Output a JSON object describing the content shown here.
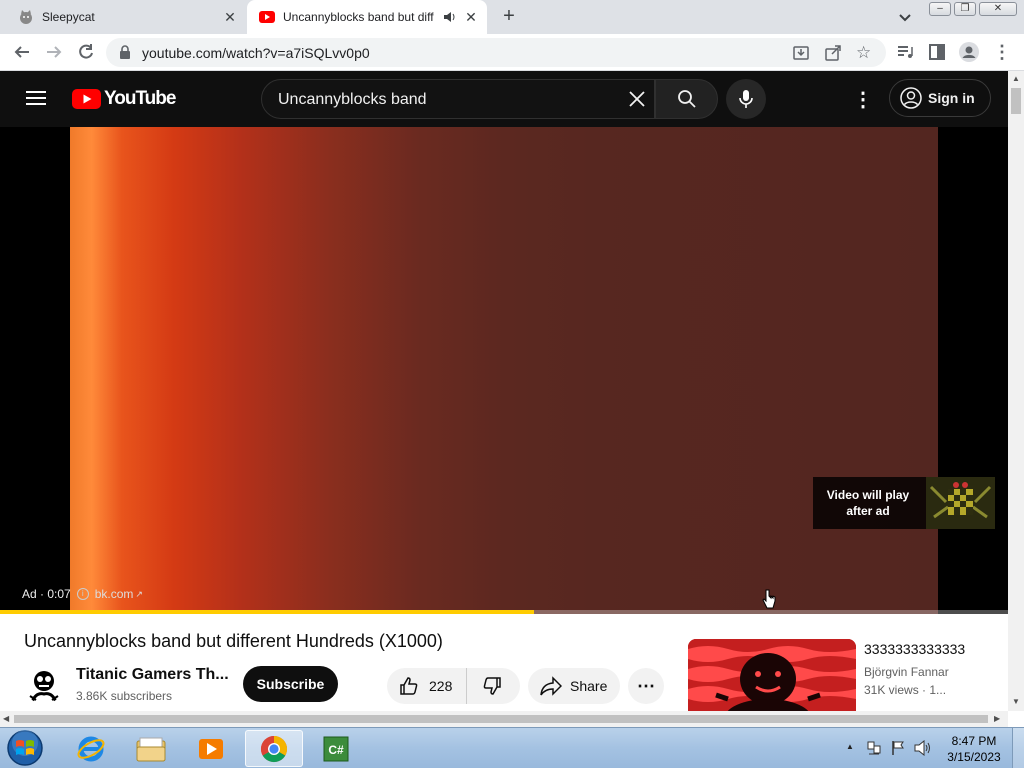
{
  "browser": {
    "tabs": [
      {
        "title": "Sleepycat",
        "active": false
      },
      {
        "title": "Uncannyblocks band but diff",
        "active": true
      }
    ],
    "url": "youtube.com/watch?v=a7iSQLvv0p0"
  },
  "youtube": {
    "logo_text": "YouTube",
    "search_query": "Uncannyblocks band",
    "signin_label": "Sign in"
  },
  "player": {
    "ad_label": "Ad · 0:07",
    "ad_domain": "bk.com",
    "ad_tile_text": "Video will play after ad",
    "progress_fraction": 0.53
  },
  "video": {
    "title": "Uncannyblocks band but different Hundreds (X1000)",
    "channel": "Titanic Gamers Th...",
    "subscribers": "3.86K subscribers",
    "subscribe_label": "Subscribe",
    "likes": "228",
    "share_label": "Share"
  },
  "recommended": {
    "title": "3333333333333",
    "channel": "Björgvin Fannar",
    "meta": "31K views · 1..."
  },
  "taskbar": {
    "time": "8:47 PM",
    "date": "3/15/2023"
  },
  "colors": {
    "yt_red": "#ff0000",
    "progress_yellow": "#ffcc00"
  }
}
